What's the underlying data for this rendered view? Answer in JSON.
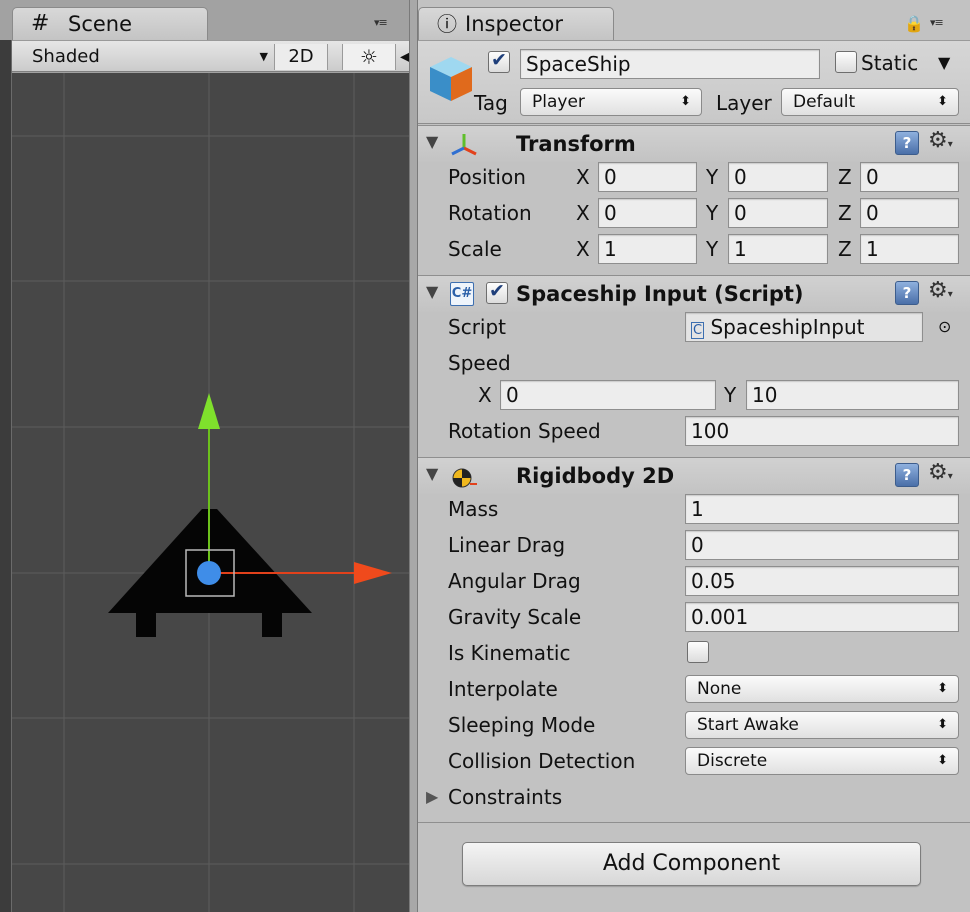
{
  "scene": {
    "tab_label": "Scene",
    "tab_icon": "grid-hash-icon",
    "menu_glyph": "▾≡",
    "shading_mode": "Shaded",
    "btn_2d": "2D",
    "light_icon": "☼",
    "audio_icon": "◀",
    "colors": {
      "viewport_bg": "#474747",
      "grid": "#5a5a5a",
      "y_arrow": "#6cc11c",
      "x_arrow": "#e2411b",
      "pivot": "#3f8de8"
    }
  },
  "inspector": {
    "tab_label": "Inspector",
    "tab_icon": "info-icon",
    "lock_icon": "🔒",
    "menu_glyph": "▾≡",
    "object": {
      "active": true,
      "name": "SpaceShip",
      "static_label": "Static",
      "static_checked": false,
      "static_menu": "▼",
      "tag_label": "Tag",
      "tag_value": "Player",
      "layer_label": "Layer",
      "layer_value": "Default"
    },
    "transform": {
      "title": "Transform",
      "rows": [
        {
          "label": "Position",
          "x": "0",
          "y": "0",
          "z": "0"
        },
        {
          "label": "Rotation",
          "x": "0",
          "y": "0",
          "z": "0"
        },
        {
          "label": "Scale",
          "x": "1",
          "y": "1",
          "z": "1"
        }
      ],
      "axis_x": "X",
      "axis_y": "Y",
      "axis_z": "Z"
    },
    "script_component": {
      "title": "Spaceship Input (Script)",
      "enabled": true,
      "script_label": "Script",
      "script_value": "SpaceshipInput",
      "speed_label": "Speed",
      "speed_x": "0",
      "speed_y": "10",
      "axis_x": "X",
      "axis_y": "Y",
      "rotation_speed_label": "Rotation Speed",
      "rotation_speed_value": "100"
    },
    "rigidbody": {
      "title": "Rigidbody 2D",
      "mass_label": "Mass",
      "mass": "1",
      "linear_drag_label": "Linear Drag",
      "linear_drag": "0",
      "angular_drag_label": "Angular Drag",
      "angular_drag": "0.05",
      "gravity_scale_label": "Gravity Scale",
      "gravity_scale": "0.001",
      "is_kinematic_label": "Is Kinematic",
      "is_kinematic": false,
      "interpolate_label": "Interpolate",
      "interpolate": "None",
      "sleeping_mode_label": "Sleeping Mode",
      "sleeping_mode": "Start Awake",
      "collision_detection_label": "Collision Detection",
      "collision_detection": "Discrete",
      "constraints_label": "Constraints"
    },
    "help_glyph": "?",
    "gear_glyph": "⚙",
    "updown_glyph": "⬍",
    "add_component_label": "Add Component"
  }
}
